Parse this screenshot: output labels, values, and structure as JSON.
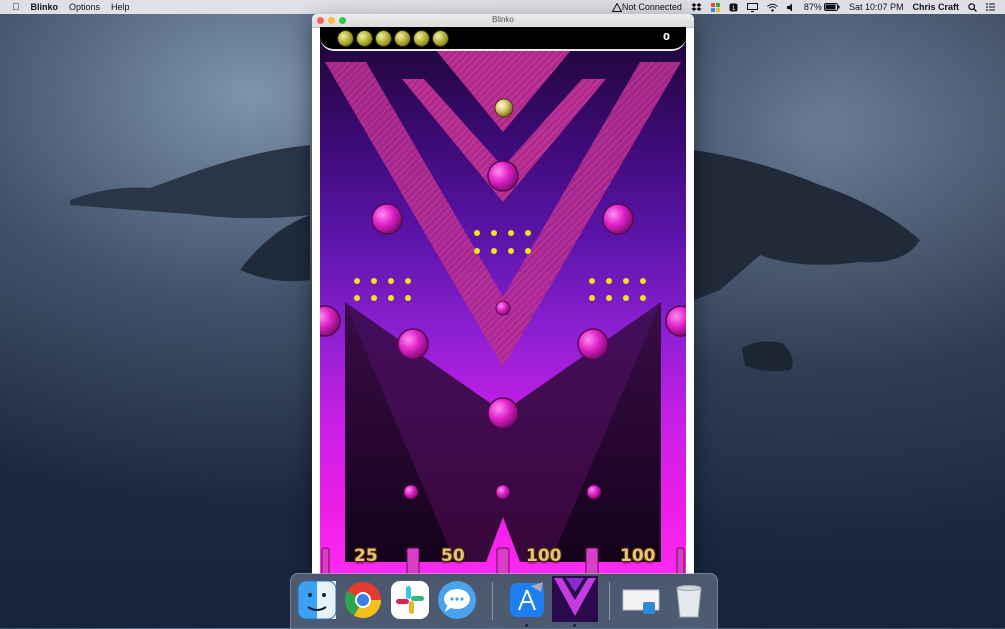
{
  "menubar": {
    "app_name": "Blinko",
    "menus": [
      "Options",
      "Help"
    ],
    "network_status": "Not Connected",
    "battery": "87%",
    "clock": "Sat 10:07 PM",
    "user": "Chris Craft"
  },
  "window": {
    "title": "Blinko"
  },
  "game": {
    "score": "0",
    "lives_remaining": 6,
    "slot_values": [
      "25",
      "50",
      "100",
      "100"
    ]
  },
  "dock": {
    "apps": [
      "finder",
      "chrome",
      "slack",
      "messages",
      "xcode",
      "blinko",
      "preview",
      "trash"
    ]
  },
  "colors": {
    "menubar_bg": "#ececf0",
    "peg_magenta": "#e022c8",
    "slot_text": "#e6c37b",
    "board_top": "#1c0633",
    "board_bottom": "#ff29f2"
  }
}
